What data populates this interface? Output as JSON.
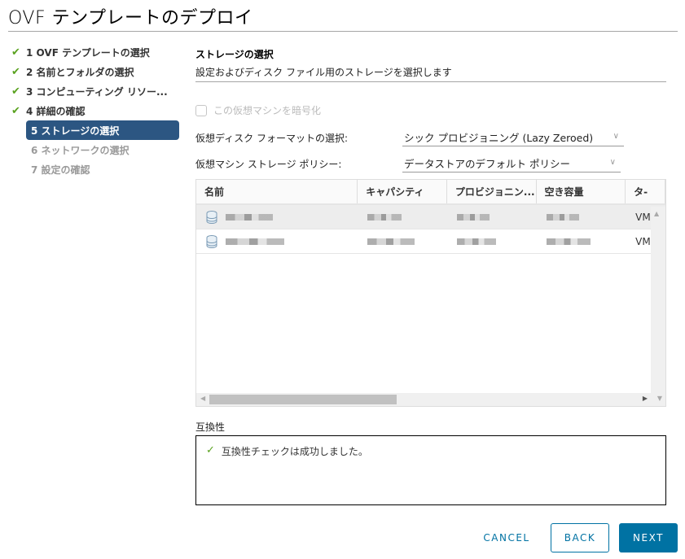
{
  "dialog": {
    "title": "OVF テンプレートのデプロイ"
  },
  "steps": [
    {
      "label": "1 OVF テンプレートの選択",
      "state": "done"
    },
    {
      "label": "2 名前とフォルダの選択",
      "state": "done"
    },
    {
      "label": "3 コンピューティング リソー...",
      "state": "done"
    },
    {
      "label": "4 詳細の確認",
      "state": "done"
    },
    {
      "label": "5 ストレージの選択",
      "state": "active"
    },
    {
      "label": "6 ネットワークの選択",
      "state": "future"
    },
    {
      "label": "7 設定の確認",
      "state": "future"
    }
  ],
  "content": {
    "title": "ストレージの選択",
    "subtitle": "設定およびディスク ファイル用のストレージを選択します",
    "encrypt_label": "この仮想マシンを暗号化",
    "disk_format": {
      "label": "仮想ディスク フォーマットの選択:",
      "value": "シック プロビジョニング (Lazy Zeroed)"
    },
    "storage_policy": {
      "label": "仮想マシン ストレージ ポリシー:",
      "value": "データストアのデフォルト ポリシー"
    }
  },
  "table": {
    "columns": [
      "名前",
      "キャパシティ",
      "プロビジョニン...",
      "空き容量",
      "タ-"
    ],
    "rows": [
      {
        "name": "[redacted]",
        "capacity": "[redacted]",
        "provisioned": "[redacted]",
        "free": "[redacted]",
        "type": "VM",
        "selected": true
      },
      {
        "name": "[redacted]",
        "capacity": "[redacted]",
        "provisioned": "[redacted]",
        "free": "[redacted]",
        "type": "VM",
        "selected": false
      }
    ]
  },
  "compatibility": {
    "label": "互換性",
    "message": "互換性チェックは成功しました。"
  },
  "buttons": {
    "cancel": "CANCEL",
    "back": "BACK",
    "next": "NEXT"
  },
  "colors": {
    "accent": "#0072a3",
    "active_step": "#2c5682",
    "success": "#5aa220"
  }
}
